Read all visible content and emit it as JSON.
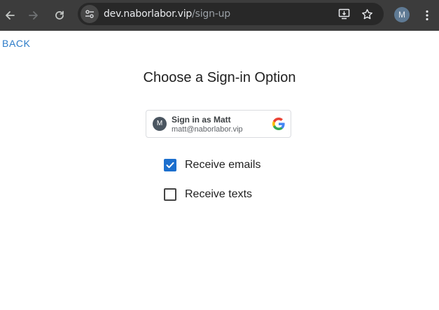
{
  "browser": {
    "url_host": "dev.naborlabor.vip",
    "url_path": "/sign-up",
    "profile_initial": "M",
    "icons": [
      "back-arrow-icon",
      "forward-arrow-icon",
      "reload-icon",
      "site-info-icon",
      "install-app-icon",
      "bookmark-star-icon",
      "kebab-menu-icon"
    ]
  },
  "page": {
    "back_label": "BACK",
    "title": "Choose a Sign-in Option",
    "google_button": {
      "avatar_initial": "M",
      "name": "Sign in as Matt",
      "email": "matt@naborlabor.vip"
    },
    "options": [
      {
        "label": "Receive emails",
        "checked": true
      },
      {
        "label": "Receive texts",
        "checked": false
      }
    ]
  },
  "colors": {
    "chrome_bg": "#3c3c3c",
    "omnibox_bg": "#282828",
    "link": "#2b7bc8",
    "checkbox_checked": "#1c6fce"
  }
}
